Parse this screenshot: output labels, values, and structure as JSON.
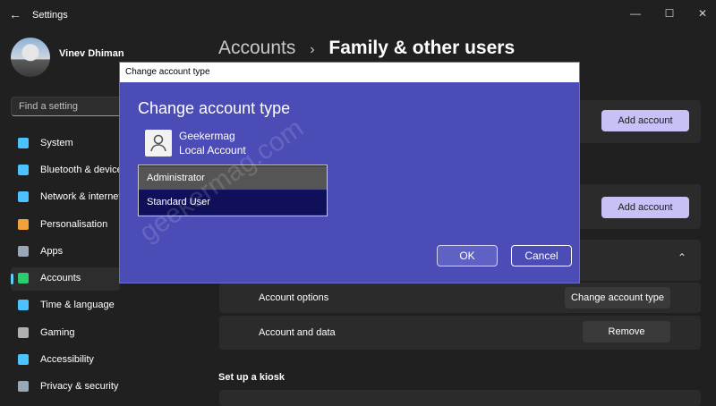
{
  "app": {
    "title": "Settings"
  },
  "user": {
    "name": "Vinev Dhiman"
  },
  "search": {
    "placeholder": "Find a setting"
  },
  "sidebar": {
    "items": [
      {
        "label": "System",
        "icon": "monitor-icon",
        "color": "#4cc2ff"
      },
      {
        "label": "Bluetooth & devices",
        "icon": "bluetooth-icon",
        "color": "#4cc2ff"
      },
      {
        "label": "Network & internet",
        "icon": "wifi-icon",
        "color": "#4cc2ff"
      },
      {
        "label": "Personalisation",
        "icon": "brush-icon",
        "color": "#f0a33b"
      },
      {
        "label": "Apps",
        "icon": "apps-icon",
        "color": "#9aa7b5"
      },
      {
        "label": "Accounts",
        "icon": "person-icon",
        "color": "#2ecc71"
      },
      {
        "label": "Time & language",
        "icon": "globe-clock-icon",
        "color": "#4cc2ff"
      },
      {
        "label": "Gaming",
        "icon": "controller-icon",
        "color": "#b0b0b0"
      },
      {
        "label": "Accessibility",
        "icon": "accessibility-icon",
        "color": "#4cc2ff"
      },
      {
        "label": "Privacy & security",
        "icon": "shield-icon",
        "color": "#9aa7b5"
      }
    ],
    "active": "Accounts"
  },
  "header": {
    "parent": "Accounts",
    "separator": "›",
    "current": "Family & other users"
  },
  "main": {
    "add_account_1": "Add account",
    "add_account_2": "Add account",
    "account_options_label": "Account options",
    "change_account_type_button": "Change account type",
    "account_data_label": "Account and data",
    "remove_button": "Remove",
    "kiosk_heading": "Set up a kiosk"
  },
  "dialog": {
    "window_title": "Change account type",
    "heading": "Change account type",
    "account_name": "Geekermag",
    "account_type": "Local Account",
    "options": [
      "Administrator",
      "Standard User"
    ],
    "selected": "Standard User",
    "ok_label": "OK",
    "cancel_label": "Cancel"
  },
  "watermark": "geekermag.com",
  "colors": {
    "accent": "#60cdff",
    "dialog_bg": "#4b4cb5",
    "button_accent": "#c7c1f5"
  }
}
